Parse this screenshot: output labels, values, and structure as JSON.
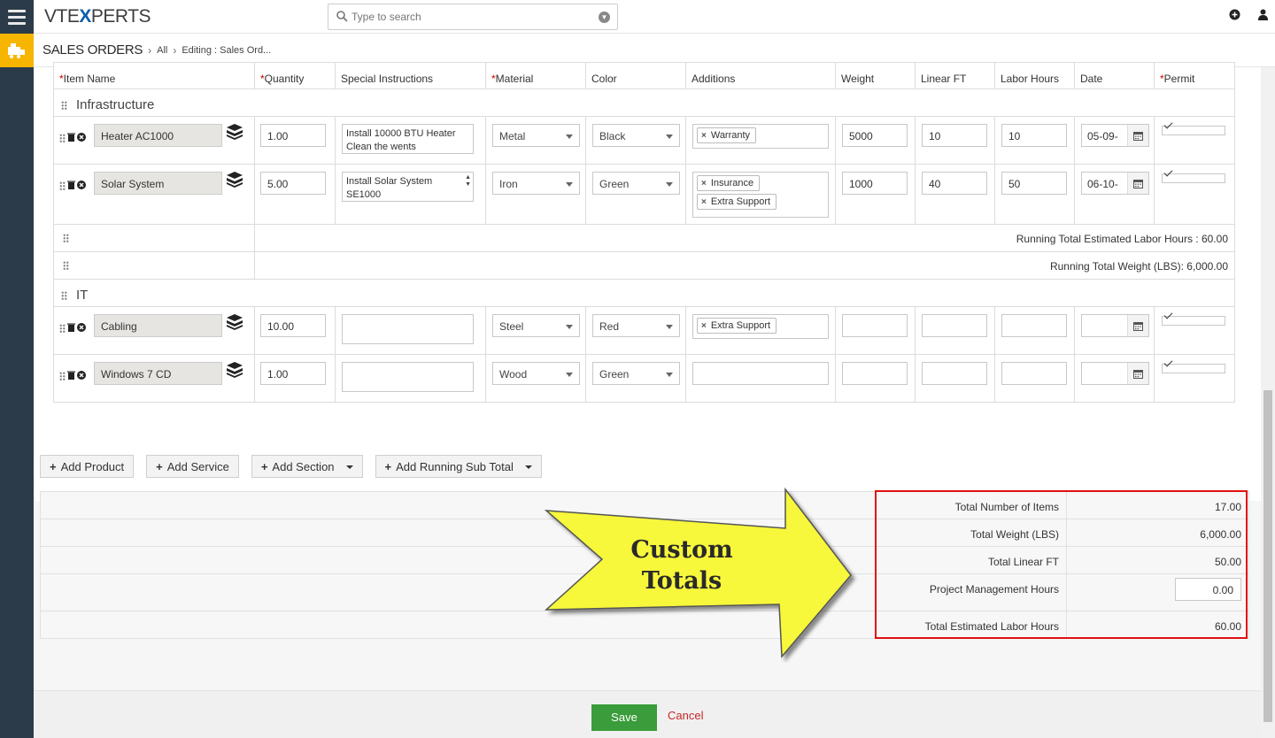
{
  "app": {
    "logo_pre": "VTE",
    "logo_x": "X",
    "logo_post": "PERTS"
  },
  "search": {
    "placeholder": "Type to search"
  },
  "breadcrumb": {
    "module": "SALES ORDERS",
    "all": "All",
    "current": "Editing : Sales Ord..."
  },
  "columns": [
    "*Item Name",
    "*Quantity",
    "Special Instructions",
    "*Material",
    "Color",
    "Additions",
    "Weight",
    "Linear FT",
    "Labor Hours",
    "Date",
    "*Permit"
  ],
  "headers": {
    "item_name": "Item Name",
    "quantity": "Quantity",
    "special": "Special Instructions",
    "material": "Material",
    "color": "Color",
    "additions": "Additions",
    "weight": "Weight",
    "linear": "Linear FT",
    "labor": "Labor Hours",
    "date": "Date",
    "permit": "Permit",
    "req": "*"
  },
  "sections": [
    {
      "title": "Infrastructure",
      "items": [
        {
          "name": "Heater AC1000",
          "qty": "1.00",
          "instructions": "Install 10000 BTU Heater Clean the wents",
          "material": "Metal",
          "color": "Black",
          "additions": [
            "Warranty"
          ],
          "weight": "5000",
          "linear": "10",
          "labor": "10",
          "date": "05-09-"
        },
        {
          "name": "Solar System",
          "qty": "5.00",
          "instructions": "Install Solar System SE1000",
          "material": "Iron",
          "color": "Green",
          "additions": [
            "Insurance",
            "Extra Support"
          ],
          "weight": "1000",
          "linear": "40",
          "labor": "50",
          "date": "06-10-"
        }
      ],
      "running": [
        "Running Total Estimated Labor Hours : 60.00",
        "Running Total Weight (LBS): 6,000.00"
      ]
    },
    {
      "title": "IT",
      "items": [
        {
          "name": "Cabling",
          "qty": "10.00",
          "instructions": "",
          "material": "Steel",
          "color": "Red",
          "additions": [
            "Extra Support"
          ],
          "weight": "",
          "linear": "",
          "labor": "",
          "date": ""
        },
        {
          "name": "Windows 7 CD",
          "qty": "1.00",
          "instructions": "",
          "material": "Wood",
          "color": "Green",
          "additions": [],
          "weight": "",
          "linear": "",
          "labor": "",
          "date": ""
        }
      ]
    }
  ],
  "buttons": {
    "add_product": "Add Product",
    "add_service": "Add Service",
    "add_section": "Add Section",
    "add_running": "Add Running Sub Total"
  },
  "totals": [
    {
      "label": "Total Number of Items",
      "value": "17.00"
    },
    {
      "label": "Total Weight (LBS)",
      "value": "6,000.00"
    },
    {
      "label": "Total Linear FT",
      "value": "50.00"
    },
    {
      "label": "Project Management Hours",
      "value": "0.00"
    },
    {
      "label": "Total Estimated Labor Hours",
      "value": "60.00"
    }
  ],
  "callout": {
    "line1": "Custom",
    "line2": "Totals"
  },
  "footer": {
    "save": "Save",
    "cancel": "Cancel"
  },
  "colors": {
    "sidebar": "#2c3b49",
    "module_accent": "#f7b500",
    "save": "#3a9c3a",
    "cancel": "#c62828",
    "highlight": "#e01010",
    "callout_fill": "#f7f73a"
  }
}
